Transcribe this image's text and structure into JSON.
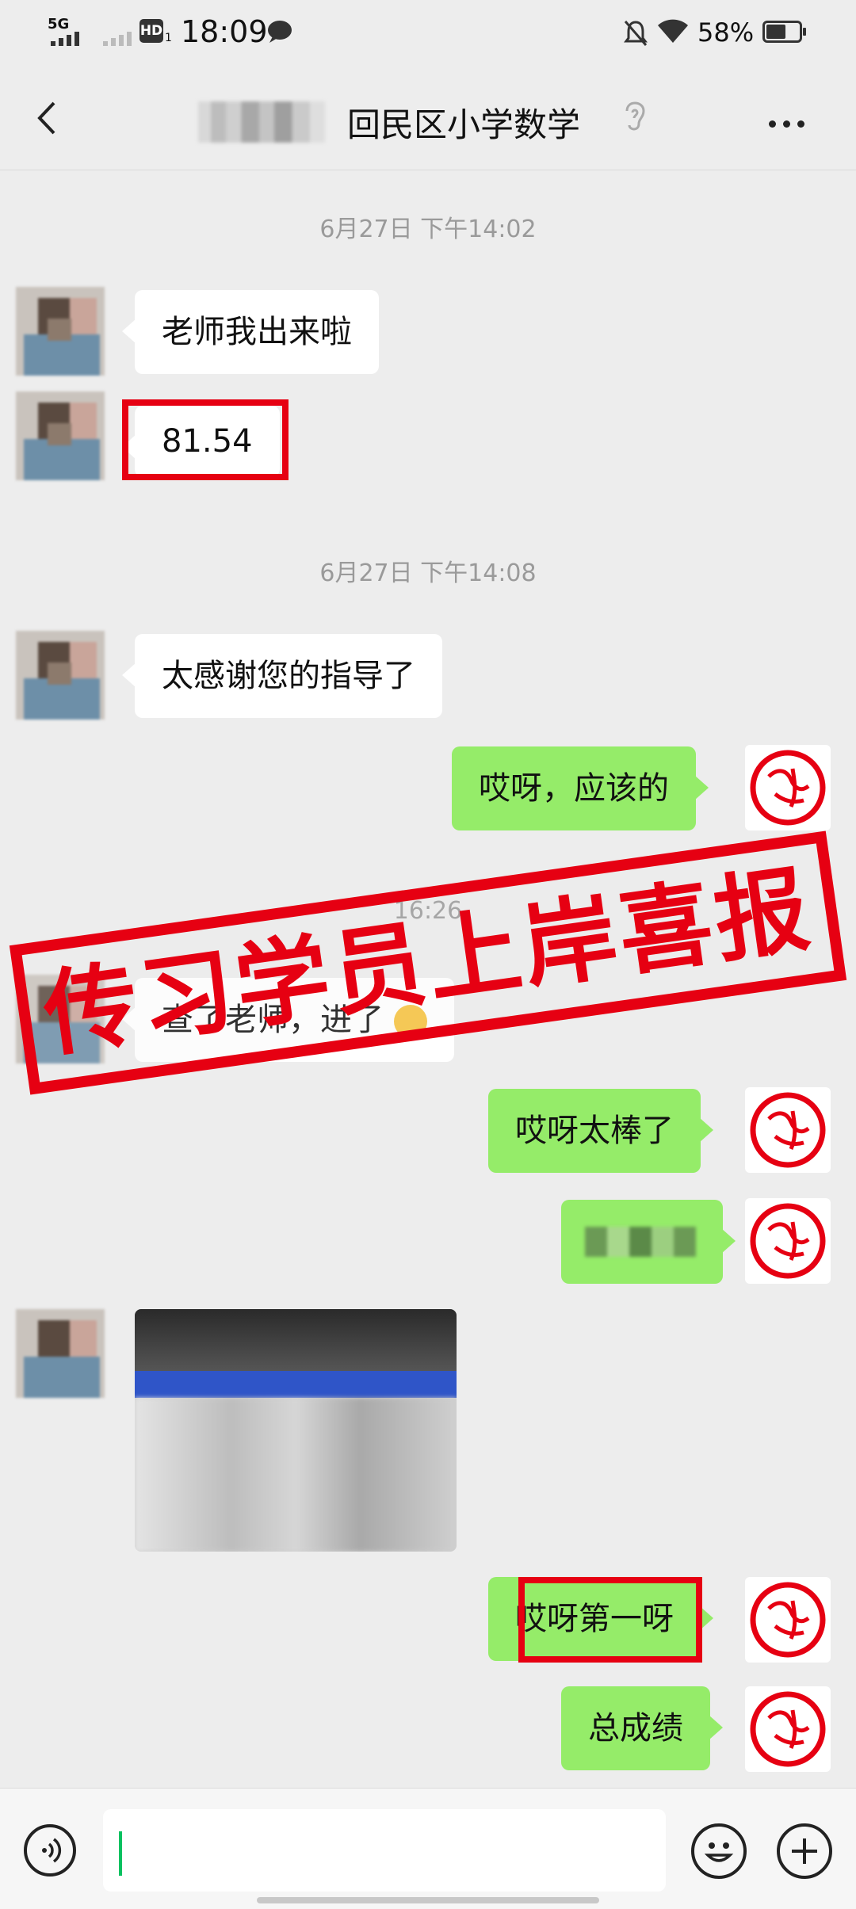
{
  "status_bar": {
    "network": "5G",
    "hd": "HD",
    "hd_sub": "1",
    "time": "18:09",
    "battery": "58%"
  },
  "nav": {
    "title": "回民区小学数学"
  },
  "messages": {
    "ts1": "6月27日 下午14:02",
    "m1": "老师我出来啦",
    "m2": "81.54",
    "ts2": "6月27日 下午14:08",
    "m3": "太感谢您的指导了",
    "m4": "哎呀，应该的",
    "ts3": "16:26",
    "m5": "查了老师，进了",
    "m6": "哎呀太棒了",
    "m8": "哎呀第一呀",
    "m9": "总成绩"
  },
  "banner": {
    "text": "传习学员上岸喜报"
  },
  "colors": {
    "accent_green": "#95ec69",
    "highlight_red": "#e60012",
    "background": "#ededed"
  }
}
